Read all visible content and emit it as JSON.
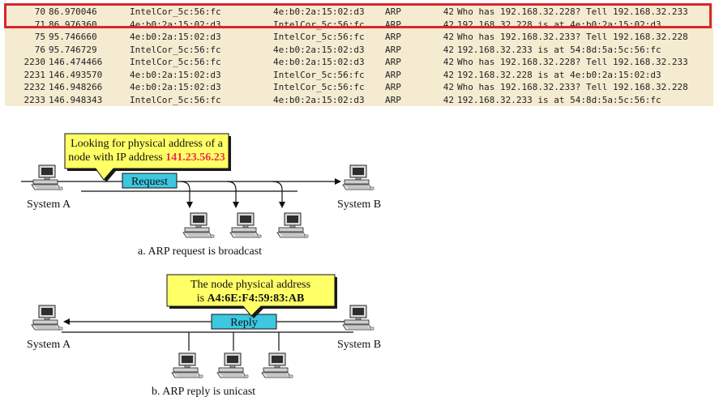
{
  "packets": [
    {
      "no": "70",
      "time": "86.970046",
      "source": "IntelCor_5c:56:fc",
      "destination": "4e:b0:2a:15:02:d3",
      "protocol": "ARP",
      "length": "42",
      "info": "Who has 192.168.32.228? Tell 192.168.32.233"
    },
    {
      "no": "71",
      "time": "86.976360",
      "source": "4e:b0:2a:15:02:d3",
      "destination": "IntelCor_5c:56:fc",
      "protocol": "ARP",
      "length": "42",
      "info": "192.168.32.228 is at 4e:b0:2a:15:02:d3"
    },
    {
      "no": "75",
      "time": "95.746660",
      "source": "4e:b0:2a:15:02:d3",
      "destination": "IntelCor_5c:56:fc",
      "protocol": "ARP",
      "length": "42",
      "info": "Who has 192.168.32.233? Tell 192.168.32.228"
    },
    {
      "no": "76",
      "time": "95.746729",
      "source": "IntelCor_5c:56:fc",
      "destination": "4e:b0:2a:15:02:d3",
      "protocol": "ARP",
      "length": "42",
      "info": "192.168.32.233 is at 54:8d:5a:5c:56:fc"
    },
    {
      "no": "2230",
      "time": "146.474466",
      "source": "IntelCor_5c:56:fc",
      "destination": "4e:b0:2a:15:02:d3",
      "protocol": "ARP",
      "length": "42",
      "info": "Who has 192.168.32.228? Tell 192.168.32.233"
    },
    {
      "no": "2231",
      "time": "146.493570",
      "source": "4e:b0:2a:15:02:d3",
      "destination": "IntelCor_5c:56:fc",
      "protocol": "ARP",
      "length": "42",
      "info": "192.168.32.228 is at 4e:b0:2a:15:02:d3"
    },
    {
      "no": "2232",
      "time": "146.948266",
      "source": "4e:b0:2a:15:02:d3",
      "destination": "IntelCor_5c:56:fc",
      "protocol": "ARP",
      "length": "42",
      "info": "Who has 192.168.32.233? Tell 192.168.32.228"
    },
    {
      "no": "2233",
      "time": "146.948343",
      "source": "IntelCor_5c:56:fc",
      "destination": "4e:b0:2a:15:02:d3",
      "protocol": "ARP",
      "length": "42",
      "info": "192.168.32.233 is at 54:8d:5a:5c:56:fc"
    }
  ],
  "colors": {
    "table_bg": "#f5ebd1",
    "highlight_border": "#d8262f",
    "callout_fill": "#ffff66",
    "message_box_fill": "#3ec7e0",
    "ip_highlight": "#e8314a"
  },
  "diagram_a": {
    "callout_line1": "Looking for physical address of a",
    "callout_line2_prefix": "node with IP address ",
    "callout_ip": "141.23.56.23",
    "message_label": "Request",
    "system_a": "System A",
    "system_b": "System B",
    "caption": "a. ARP request is broadcast"
  },
  "diagram_b": {
    "callout_line1": "The node physical address",
    "callout_line2_prefix": "is ",
    "callout_mac": "A4:6E:F4:59:83:AB",
    "message_label": "Reply",
    "system_a": "System A",
    "system_b": "System B",
    "caption": "b. ARP reply is unicast"
  }
}
